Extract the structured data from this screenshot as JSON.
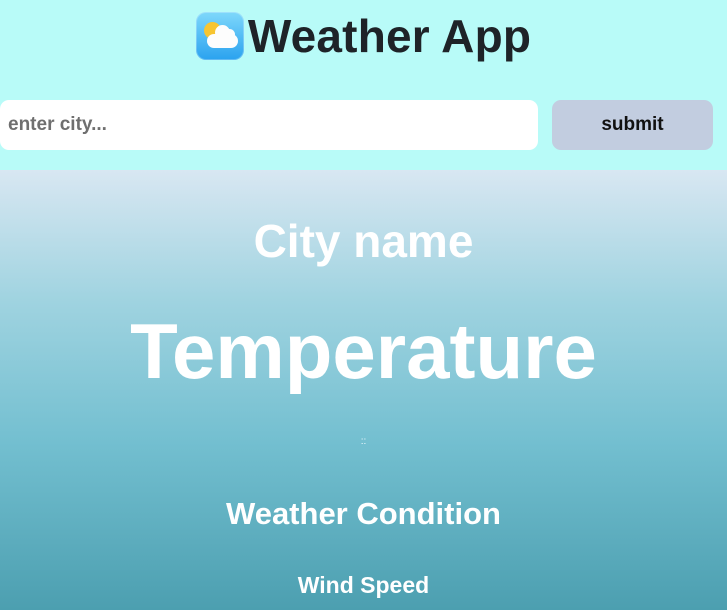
{
  "header": {
    "icon": "weather-sun-cloud-icon",
    "title": "Weather App"
  },
  "search": {
    "placeholder": "enter city...",
    "value": "",
    "submit_label": "submit"
  },
  "weather": {
    "city_name": "City name",
    "temperature": "Temperature",
    "time": "::",
    "condition": "Weather Condition",
    "wind_speed": "Wind Speed"
  },
  "colors": {
    "header_bg": "#b8fbf8",
    "submit_bg": "#c2cde0",
    "panel_top": "#d8e7f2",
    "panel_bottom": "#4c9fb0",
    "weather_text": "#ffffff"
  }
}
